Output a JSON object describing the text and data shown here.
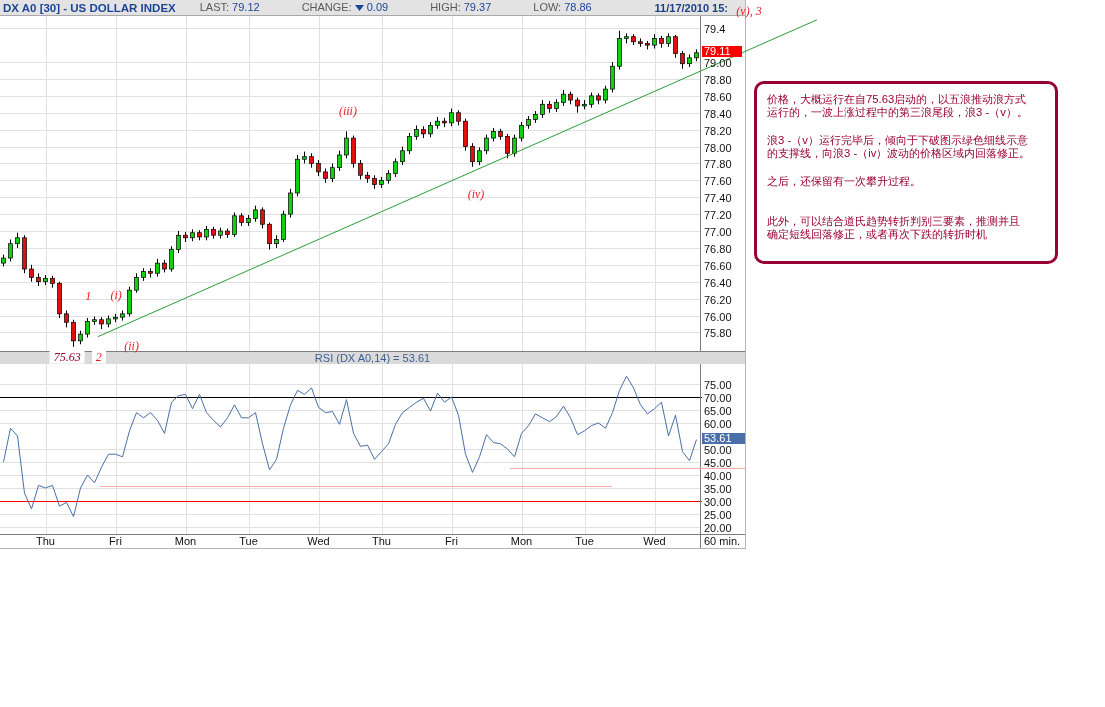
{
  "header": {
    "title": "DX A0 [30] - US DOLLAR INDEX",
    "fields": [
      {
        "label": "LAST:",
        "value": "79.12"
      },
      {
        "label": "CHANGE:",
        "value": "0.09",
        "falling": true
      },
      {
        "label": "HIGH:",
        "value": "79.37"
      },
      {
        "label": "LOW:",
        "value": "78.86"
      }
    ],
    "timestamp": "11/17/2010 15:"
  },
  "price_chart": {
    "axis_labels": [
      "79.4",
      "79.00",
      "78.80",
      "78.60",
      "78.40",
      "78.20",
      "78.00",
      "77.80",
      "77.60",
      "77.40",
      "77.20",
      "77.00",
      "76.80",
      "76.60",
      "76.40",
      "76.20",
      "76.00",
      "75.80"
    ],
    "value_badge": "79.11",
    "labels": [
      {
        "text": "1",
        "kind": "wave",
        "boxed": false
      },
      {
        "text": "(i)",
        "kind": "wave",
        "boxed": false
      },
      {
        "text": "(ii)",
        "kind": "wave",
        "boxed": false
      },
      {
        "text": "75.63",
        "kind": "price",
        "boxed": true
      },
      {
        "text": "2",
        "kind": "wave",
        "boxed": true
      },
      {
        "text": "(iii)",
        "kind": "wave",
        "boxed": false
      },
      {
        "text": "(iv)",
        "kind": "wave",
        "boxed": false
      },
      {
        "text": "(v), 3",
        "kind": "wave",
        "boxed": false
      }
    ]
  },
  "rsi_chart": {
    "value_badge": "53.61",
    "chart_data": {
      "type": "line",
      "title": "RSI (DX A0,14) = 53.61",
      "xlabel": "60 min.",
      "categories": [
        null,
        null,
        null,
        null,
        null,
        null,
        "Thu",
        null,
        null,
        null,
        null,
        null,
        null,
        null,
        null,
        null,
        "Fri",
        null,
        null,
        null,
        null,
        null,
        null,
        null,
        null,
        null,
        "Mon",
        null,
        null,
        null,
        null,
        null,
        null,
        null,
        null,
        "Tue",
        null,
        null,
        null,
        null,
        null,
        null,
        null,
        null,
        null,
        "Wed",
        null,
        null,
        null,
        null,
        null,
        null,
        null,
        null,
        "Thu",
        null,
        null,
        null,
        null,
        null,
        null,
        null,
        null,
        null,
        "Fri",
        null,
        null,
        null,
        null,
        null,
        null,
        null,
        null,
        null,
        "Mon",
        null,
        null,
        null,
        null,
        null,
        null,
        null,
        null,
        "Tue",
        null,
        null,
        null,
        null,
        null,
        null,
        null,
        null,
        null,
        "Wed",
        null,
        null,
        null,
        null,
        null,
        null
      ],
      "ylim": [
        17.3,
        82.7
      ],
      "yticks": [
        {
          "value": 20,
          "label": "20.00"
        },
        {
          "value": 25,
          "label": "25.00"
        },
        {
          "value": 30,
          "label": "30.00"
        },
        {
          "value": 35,
          "label": "35.00"
        },
        {
          "value": 40,
          "label": "40.00"
        },
        {
          "value": 45,
          "label": "45.00"
        },
        {
          "value": 50,
          "label": "50.00"
        },
        {
          "value": 60,
          "label": "60.00"
        },
        {
          "value": 65,
          "label": "65.00"
        },
        {
          "value": 70,
          "label": "70.00"
        },
        {
          "value": 75,
          "label": "75.00"
        }
      ],
      "series": [
        {
          "color": "#4a6fa5",
          "values": [
            45,
            58,
            55,
            33,
            27,
            36,
            35,
            36,
            28,
            29.5,
            24,
            35,
            40,
            37,
            43,
            48,
            48,
            47,
            57,
            64,
            62,
            64,
            61,
            56,
            68,
            70.5,
            71,
            65.5,
            71,
            64,
            61,
            58.5,
            62,
            67,
            62,
            62,
            64,
            52,
            42,
            46,
            58,
            67,
            72.6,
            71,
            73.5,
            66,
            64,
            64.4,
            59.5,
            69,
            56,
            51,
            51.5,
            46,
            49,
            52,
            59.5,
            64,
            66,
            68,
            69.5,
            64.6,
            71.5,
            68,
            70,
            63,
            48,
            41,
            47,
            55.5,
            52.5,
            52,
            50,
            47,
            56,
            59,
            63.5,
            62,
            60.5,
            62.5,
            66.5,
            62,
            55.5,
            57,
            59,
            60,
            58,
            64,
            72.6,
            78,
            73.5,
            67,
            63.5,
            65.5,
            68,
            55,
            63,
            49,
            45.5,
            53.6
          ]
        }
      ],
      "ref_lines": [
        {
          "axis": "y",
          "value": 70,
          "color": "#000000"
        },
        {
          "axis": "y",
          "value": 30,
          "color": "#ff0000"
        }
      ]
    }
  },
  "note": {
    "paragraphs": [
      "价格，大概运行在自75.63启动的，以五浪推动浪方式运行的，一波上涨过程中的第三浪尾段，浪3 -（v）。",
      "浪3 -（v）运行完毕后，倾向于下破图示绿色细线示意的支撑线，向浪3 -（iv）波动的价格区域内回落修正。",
      "之后，还保留有一次攀升过程。",
      "此外，可以结合道氏趋势转折判别三要素，推测并且确定短线回落修正，或者再次下跌的转折时机"
    ]
  }
}
